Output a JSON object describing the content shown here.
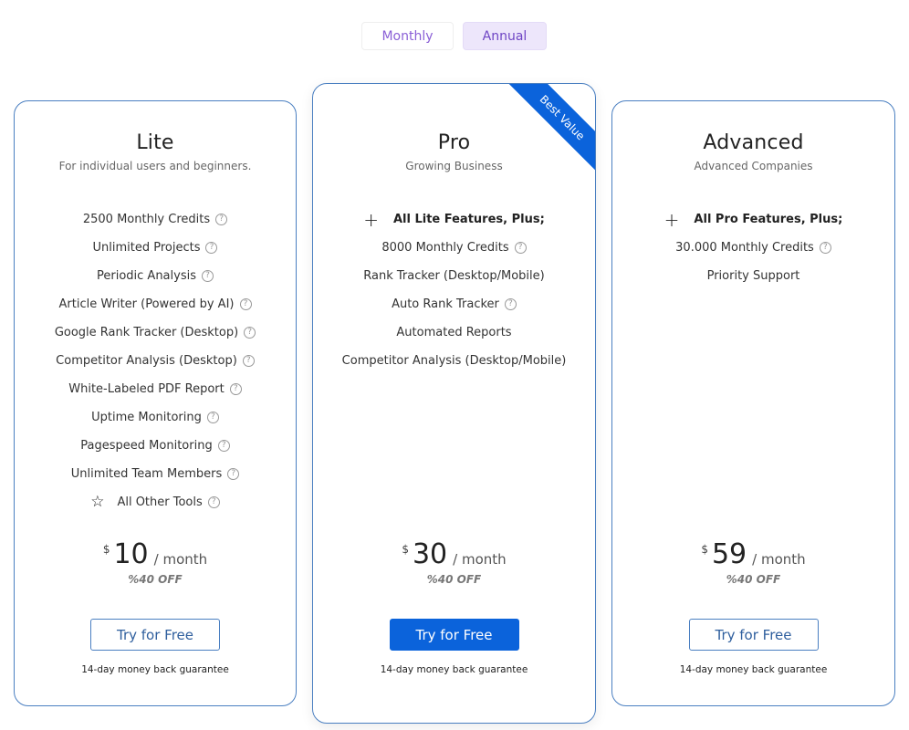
{
  "billing_toggle": {
    "options": [
      "Monthly",
      "Annual"
    ],
    "selected": "Annual"
  },
  "colors": {
    "accent": "#0b63db",
    "card_border": "#4a7fc1",
    "toggle_text": "#8a5fd6",
    "toggle_active_bg": "#ede6fb"
  },
  "plans": [
    {
      "name": "Lite",
      "subtitle": "For individual users and beginners.",
      "features": [
        {
          "label": "2500 Monthly Credits",
          "help": true
        },
        {
          "label": "Unlimited Projects",
          "help": true
        },
        {
          "label": "Periodic Analysis",
          "help": true
        },
        {
          "label": "Article Writer (Powered by AI)",
          "help": true
        },
        {
          "label": "Google Rank Tracker (Desktop)",
          "help": true
        },
        {
          "label": "Competitor Analysis (Desktop)",
          "help": true
        },
        {
          "label": "White-Labeled PDF Report",
          "help": true
        },
        {
          "label": "Uptime Monitoring",
          "help": true
        },
        {
          "label": "Pagespeed Monitoring",
          "help": true
        },
        {
          "label": "Unlimited Team Members",
          "help": true
        },
        {
          "label": "All Other Tools",
          "help": true,
          "icon": "star-icon"
        }
      ],
      "currency": "$",
      "price": "10",
      "period": "/  month",
      "discount": "%40 OFF",
      "cta": "Try for Free",
      "guarantee": "14-day money back guarantee"
    },
    {
      "name": "Pro",
      "subtitle": "Growing Business",
      "ribbon": "Best Value",
      "features": [
        {
          "label": "All Lite Features, Plus;",
          "bold": true,
          "icon": "plus-icon"
        },
        {
          "label": "8000 Monthly Credits",
          "help": true
        },
        {
          "label": "Rank Tracker (Desktop/Mobile)"
        },
        {
          "label": "Auto Rank Tracker",
          "help": true
        },
        {
          "label": "Automated Reports"
        },
        {
          "label": "Competitor Analysis (Desktop/Mobile)"
        }
      ],
      "currency": "$",
      "price": "30",
      "period": "/  month",
      "discount": "%40 OFF",
      "cta": "Try for Free",
      "guarantee": "14-day money back guarantee"
    },
    {
      "name": "Advanced",
      "subtitle": "Advanced Companies",
      "features": [
        {
          "label": "All Pro Features, Plus;",
          "bold": true,
          "icon": "plus-icon"
        },
        {
          "label": "30.000 Monthly Credits",
          "help": true
        },
        {
          "label": "Priority Support"
        }
      ],
      "currency": "$",
      "price": "59",
      "period": "/  month",
      "discount": "%40 OFF",
      "cta": "Try for Free",
      "guarantee": "14-day money back guarantee"
    }
  ]
}
